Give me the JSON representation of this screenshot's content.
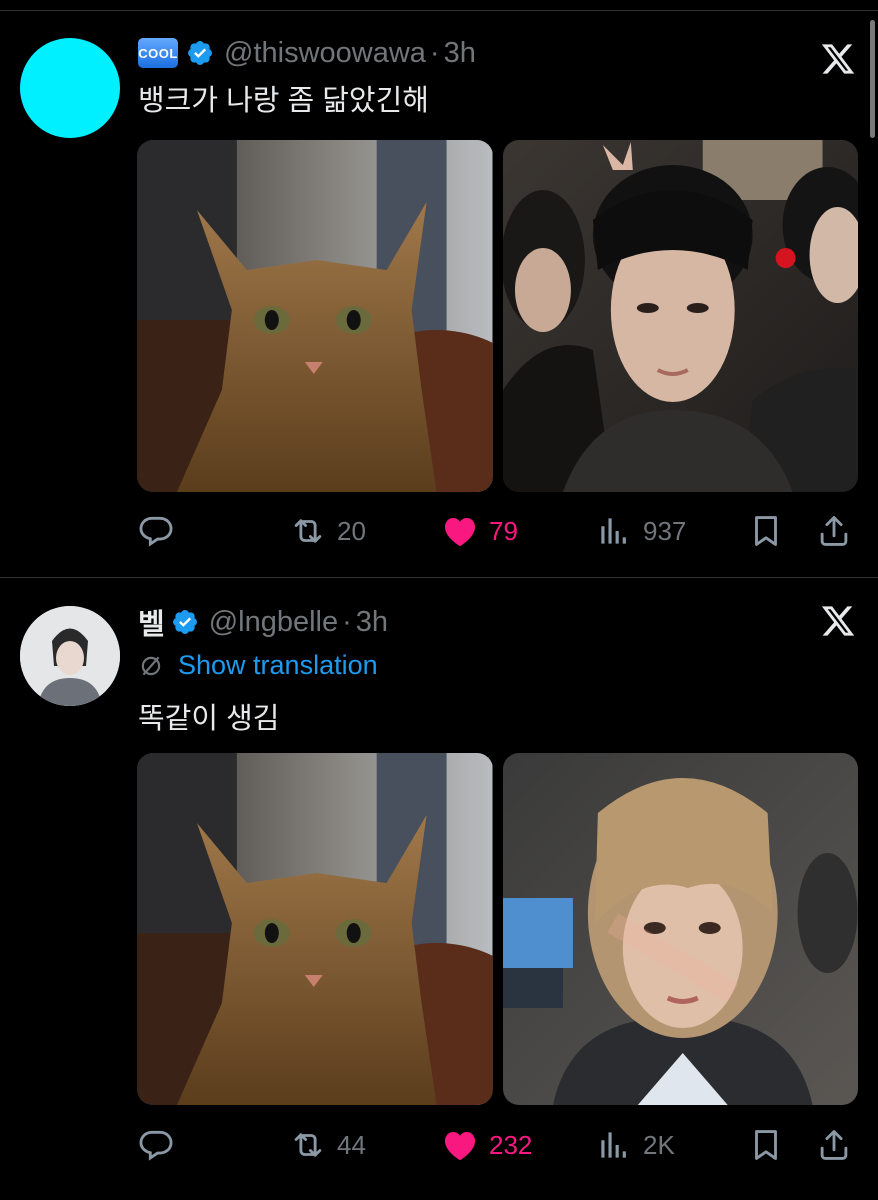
{
  "colors": {
    "background": "#000000",
    "text": "#e7e9ea",
    "muted": "#71767b",
    "link": "#1d9bf0",
    "like": "#f91880",
    "verified": "#1d9bf0",
    "avatar1": "#00f0ff"
  },
  "tweets": [
    {
      "badge": "COOL",
      "display_name": "",
      "handle": "@thiswoowawa",
      "separator": "·",
      "time": "3h",
      "translation_label": "",
      "text": "뱅크가 나랑 좀 닮았긴해",
      "media": [
        {
          "icon": "cat-photo"
        },
        {
          "icon": "group-selfie-photo"
        }
      ],
      "stats": {
        "replies": "",
        "retweets": "20",
        "likes": "79",
        "views": "937"
      }
    },
    {
      "badge": "",
      "display_name": "벨",
      "handle": "@lngbelle",
      "separator": "·",
      "time": "3h",
      "translation_label": "Show translation",
      "text": "똑같이 생김",
      "media": [
        {
          "icon": "cat-photo"
        },
        {
          "icon": "selfie-photo"
        }
      ],
      "stats": {
        "replies": "",
        "retweets": "44",
        "likes": "232",
        "views": "2K"
      }
    }
  ]
}
